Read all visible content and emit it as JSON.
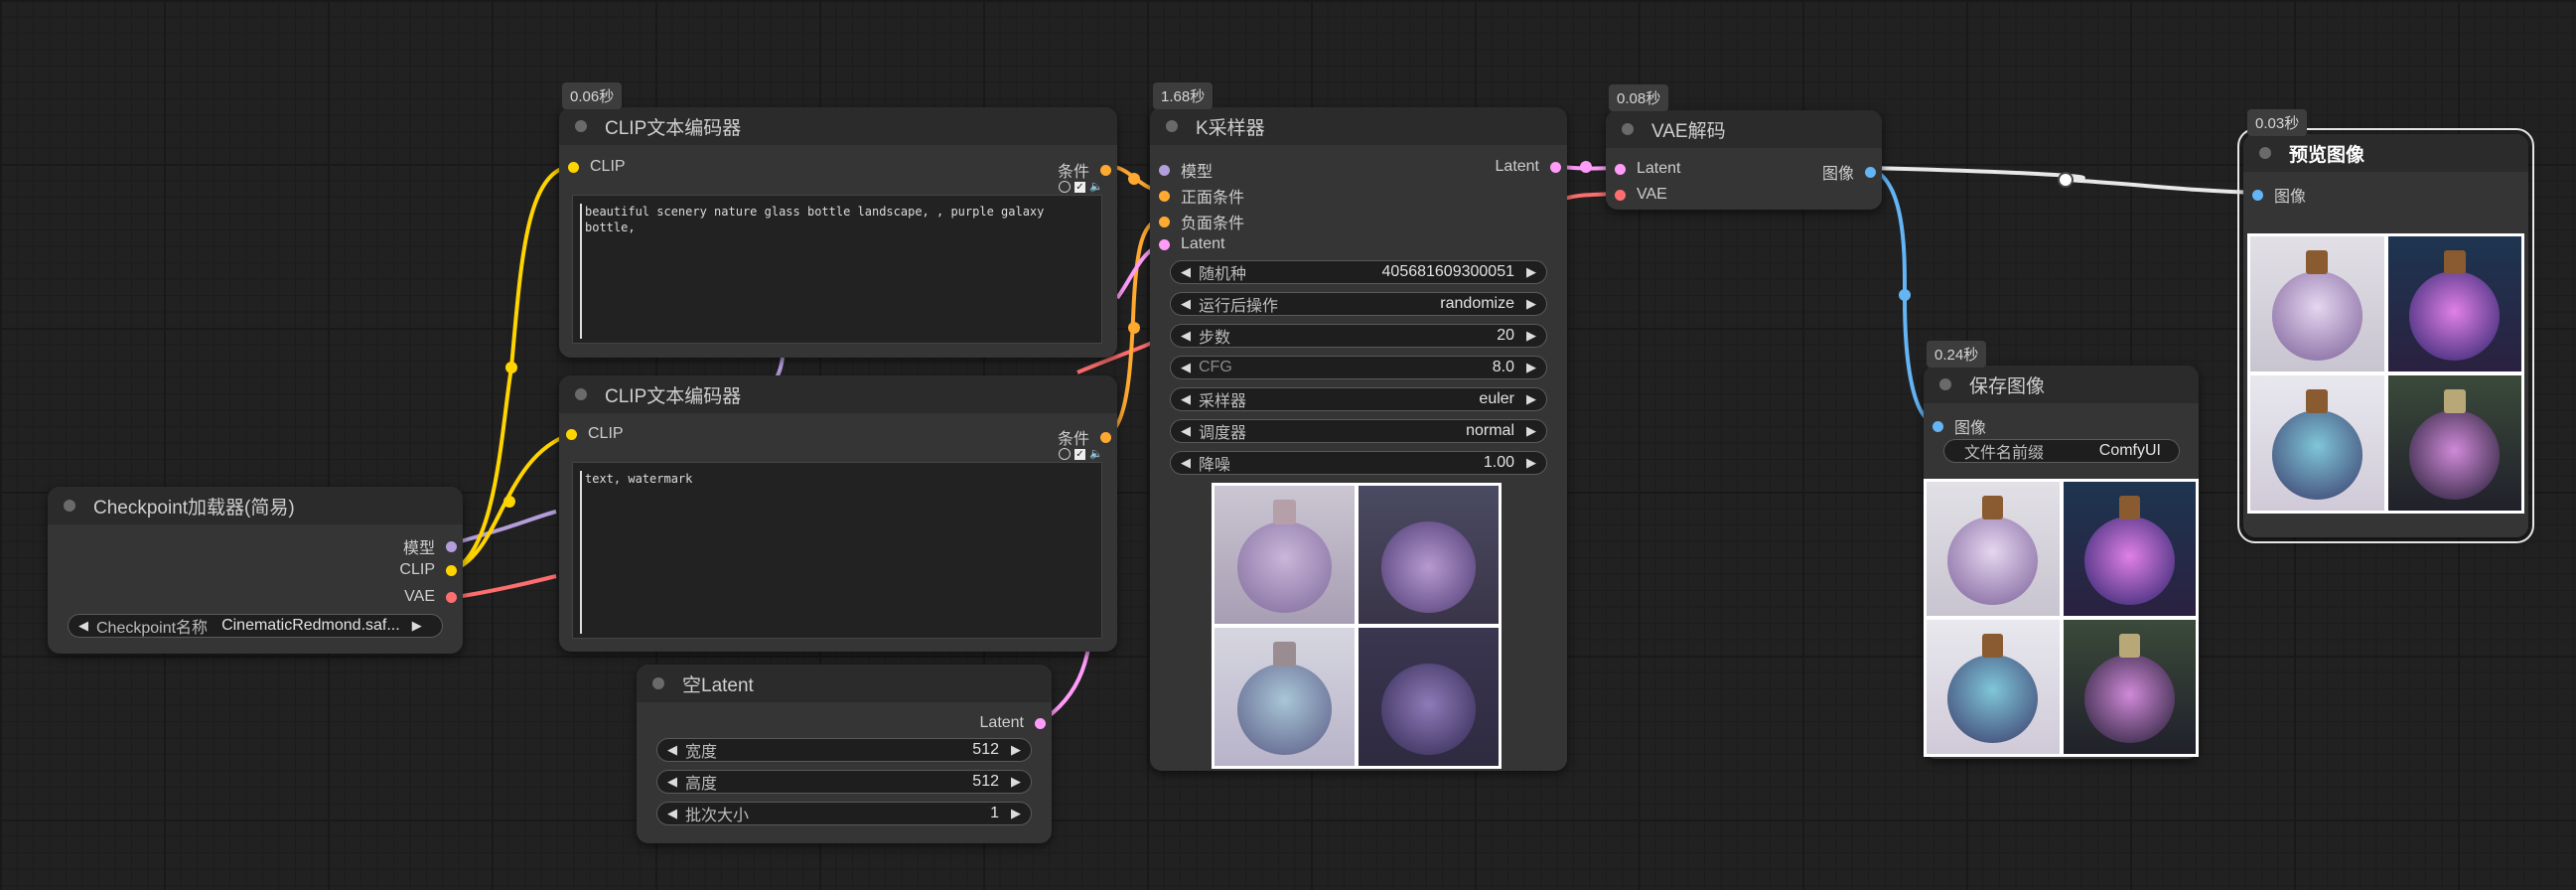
{
  "nodes": {
    "checkpoint": {
      "title": "Checkpoint加载器(简易)",
      "outputs": [
        "模型",
        "CLIP",
        "VAE"
      ],
      "widget_label": "Checkpoint名称",
      "widget_value": "CinematicRedmond.saf..."
    },
    "clip_pos": {
      "time": "0.06秒",
      "title": "CLIP文本编码器",
      "input": "CLIP",
      "output": "条件",
      "text": "beautiful scenery nature glass bottle landscape, , purple galaxy bottle,"
    },
    "clip_neg": {
      "title": "CLIP文本编码器",
      "input": "CLIP",
      "output": "条件",
      "text": "text, watermark"
    },
    "empty_latent": {
      "title": "空Latent",
      "output": "Latent",
      "widgets": [
        {
          "label": "宽度",
          "value": "512"
        },
        {
          "label": "高度",
          "value": "512"
        },
        {
          "label": "批次大小",
          "value": "1"
        }
      ]
    },
    "ksampler": {
      "time": "1.68秒",
      "title": "K采样器",
      "inputs": [
        "模型",
        "正面条件",
        "负面条件",
        "Latent"
      ],
      "output": "Latent",
      "widgets": [
        {
          "label": "随机种",
          "value": "405681609300051"
        },
        {
          "label": "运行后操作",
          "value": "randomize"
        },
        {
          "label": "步数",
          "value": "20"
        },
        {
          "label": "CFG",
          "value": "8.0"
        },
        {
          "label": "采样器",
          "value": "euler"
        },
        {
          "label": "调度器",
          "value": "normal"
        },
        {
          "label": "降噪",
          "value": "1.00"
        }
      ]
    },
    "vae_decode": {
      "time": "0.08秒",
      "title": "VAE解码",
      "inputs": [
        "Latent",
        "VAE"
      ],
      "output": "图像"
    },
    "save_image": {
      "time": "0.24秒",
      "title": "保存图像",
      "input": "图像",
      "widget_label": "文件名前缀",
      "widget_value": "ComfyUI"
    },
    "preview_image": {
      "time": "0.03秒",
      "title": "预览图像",
      "input": "图像"
    }
  },
  "colors": {
    "model": "#b39ddb",
    "clip": "#ffd500",
    "vae": "#ff6e6e",
    "conditioning": "#ffa931",
    "latent": "#ff9cf9",
    "image": "#64b5f6",
    "preview_link": "#e8e8e8"
  },
  "icons": [
    "circle-toggle-icon",
    "checkbox-icon",
    "speaker-icon",
    "arrow-left-icon",
    "arrow-right-icon"
  ]
}
